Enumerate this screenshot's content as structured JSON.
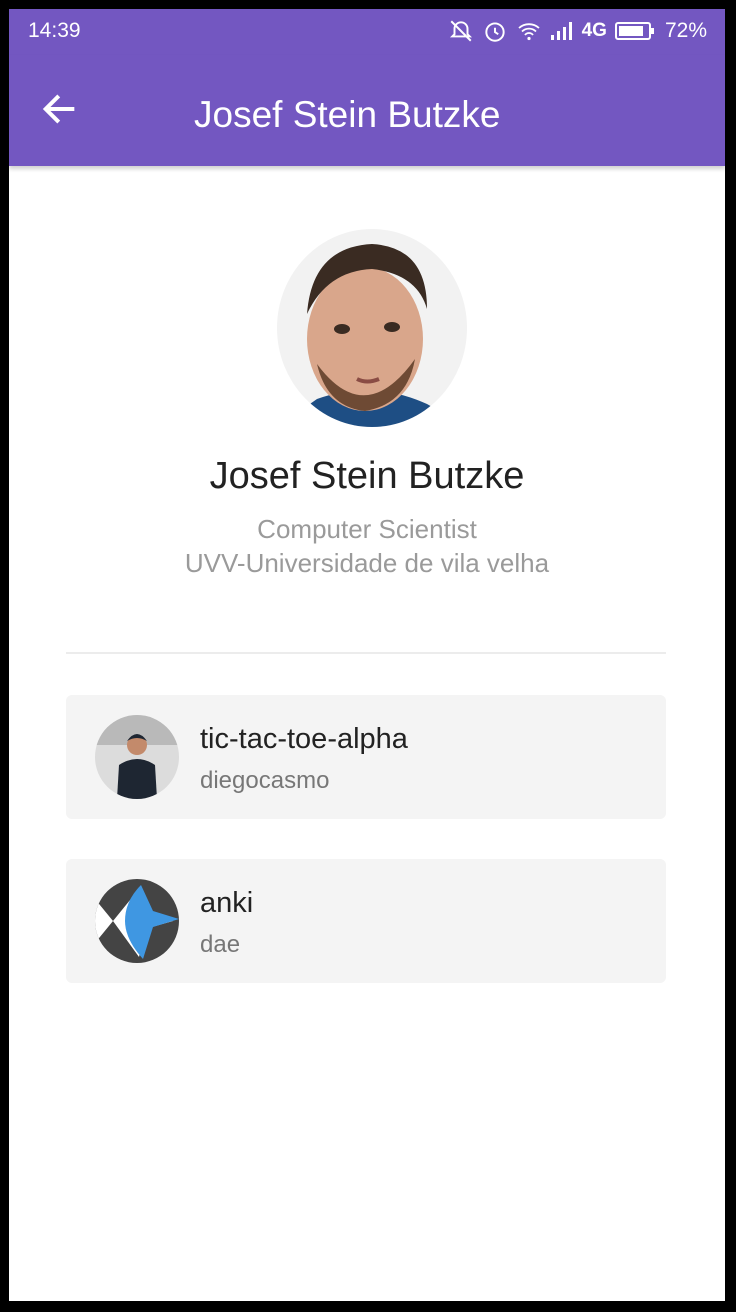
{
  "status_bar": {
    "time": "14:39",
    "network": "4G",
    "battery": "72%"
  },
  "app_bar": {
    "title": "Josef Stein Butzke"
  },
  "profile": {
    "name": "Josef Stein Butzke",
    "occupation": "Computer Scientist",
    "institution": "UVV-Universidade de vila velha"
  },
  "repositories": [
    {
      "name": "tic-tac-toe-alpha",
      "owner": "diegocasmo"
    },
    {
      "name": "anki",
      "owner": "dae"
    }
  ],
  "colors": {
    "primary": "#7357c1",
    "card": "#f4f4f4",
    "muted_text": "#9a9a9a"
  }
}
